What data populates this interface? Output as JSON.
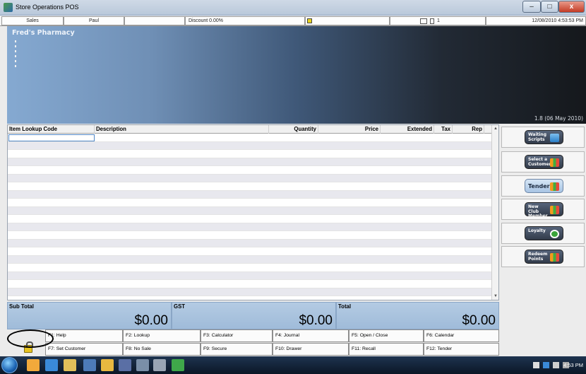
{
  "window": {
    "title": "Store Operations POS",
    "minimize": "–",
    "maximize": "□",
    "close": "x"
  },
  "statusbar": {
    "mode": "Sales",
    "cashier": "Paul",
    "blank": "",
    "discount": "Discount 0.00%",
    "indicator": "",
    "register": "1",
    "datetime": "12/08/2010 4:53:53 PM"
  },
  "banner": {
    "store_name": "Fred's Pharmacy",
    "version": "1.8 (06 May 2010)"
  },
  "grid": {
    "columns": [
      "Item Lookup Code",
      "Description",
      "Quantity",
      "Price",
      "Extended",
      "Tax",
      "Rep"
    ],
    "row_count": 20
  },
  "actions": [
    {
      "label": "Waiting Scripts",
      "icon": "pill-icon",
      "style": "dark"
    },
    {
      "label": "Select a Customer",
      "icon": "chart-icon",
      "style": "dark"
    },
    {
      "label": "Tender",
      "icon": "chart-icon",
      "style": "light"
    },
    {
      "label": "New Club Member",
      "icon": "chart-icon",
      "style": "dark"
    },
    {
      "label": "Loyalty",
      "icon": "heart-icon",
      "style": "dark"
    },
    {
      "label": "Redeem Points",
      "icon": "chart-icon",
      "style": "dark"
    }
  ],
  "totals": {
    "subtotal_label": "Sub Total",
    "subtotal_value": "$0.00",
    "gst_label": "GST",
    "gst_value": "$0.00",
    "total_label": "Total",
    "total_value": "$0.00"
  },
  "fkeys": {
    "row1": [
      "F1: Help",
      "F2: Lookup",
      "F3: Calculator",
      "F4: Journal",
      "F5: Open / Close",
      "F6: Calendar"
    ],
    "row2": [
      "F7: Set Customer",
      "F8: No Sale",
      "F9: Secure",
      "F10: Drawer",
      "F11: Recall",
      "F12: Tender"
    ]
  },
  "taskbar": {
    "clock": "4:53 PM"
  },
  "colors": {
    "total_panel": "#9fbbd9",
    "banner_left": "#85a9d1",
    "banner_right": "#15181c"
  }
}
